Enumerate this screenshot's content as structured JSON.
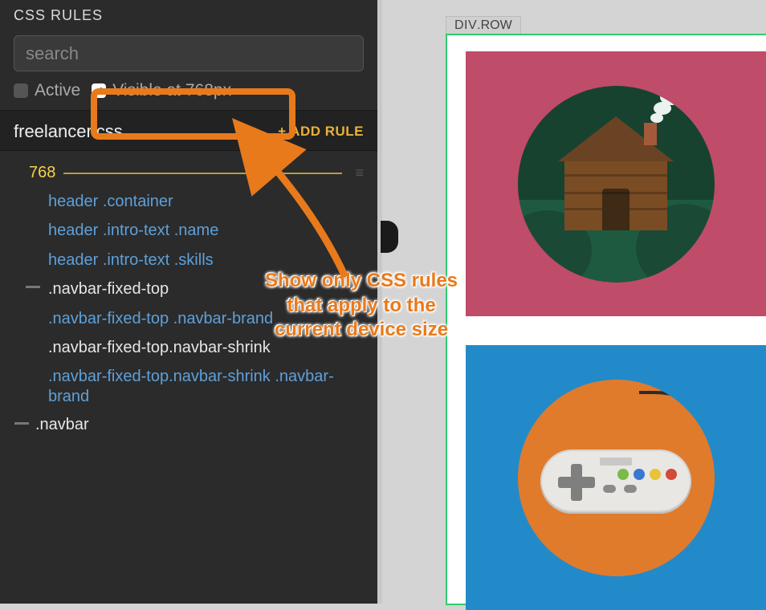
{
  "panel": {
    "title": "CSS RULES",
    "search_placeholder": "search",
    "filters": {
      "active_label": "Active",
      "active_checked": false,
      "visible_label": "Visible at 768px",
      "visible_checked": true
    },
    "file": {
      "name": "freelancer.css",
      "add_rule_label": "+ ADD RULE"
    },
    "breakpoint": "768",
    "rules": [
      {
        "selector": "header .container",
        "variant": "normal"
      },
      {
        "selector": "header .intro-text .name",
        "variant": "normal"
      },
      {
        "selector": "header .intro-text .skills",
        "variant": "normal"
      },
      {
        "selector": ".navbar-fixed-top",
        "variant": "marker"
      },
      {
        "selector": ".navbar-fixed-top .navbar-brand",
        "variant": "normal"
      },
      {
        "selector": ".navbar-fixed-top.navbar-shrink",
        "variant": "active"
      },
      {
        "selector": ".navbar-fixed-top.navbar-shrink .navbar-brand",
        "variant": "normal"
      }
    ],
    "root_rule": ".navbar"
  },
  "preview": {
    "tag_prefix": "DIV",
    "tag_class": ".ROW"
  },
  "annotation": {
    "text_line1": "Show only CSS rules",
    "text_line2": "that apply to the",
    "text_line3": "current device size"
  },
  "colors": {
    "highlight": "#e87a1b",
    "link": "#5ea0d8",
    "accent_yellow": "#f3d24a"
  }
}
